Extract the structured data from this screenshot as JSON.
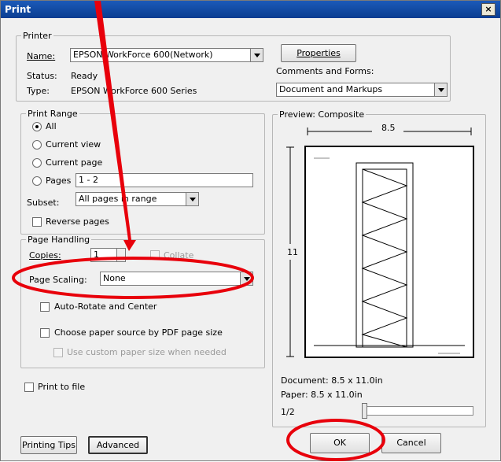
{
  "window": {
    "title": "Print",
    "close_label": "×"
  },
  "printer": {
    "legend": "Printer",
    "name_label": "Name:",
    "name_value": "EPSON WorkForce 600(Network)",
    "status_label": "Status:",
    "status_value": "Ready",
    "type_label": "Type:",
    "type_value": "EPSON WorkForce 600 Series",
    "properties_button": "Properties",
    "comments_label": "Comments and Forms:",
    "comments_value": "Document and Markups"
  },
  "print_range": {
    "legend": "Print Range",
    "all": "All",
    "current_view": "Current view",
    "current_page": "Current page",
    "pages": "Pages",
    "pages_value": "1 - 2",
    "subset_label": "Subset:",
    "subset_value": "All pages in range",
    "reverse_pages": "Reverse pages"
  },
  "page_handling": {
    "legend": "Page Handling",
    "copies_label": "Copies:",
    "copies_value": "1",
    "collate": "Collate",
    "scaling_label": "Page Scaling:",
    "scaling_value": "None",
    "auto_rotate": "Auto-Rotate and Center",
    "choose_paper": "Choose paper source by PDF page size",
    "custom_paper": "Use custom paper size when needed"
  },
  "print_to_file": "Print to file",
  "preview": {
    "legend": "Preview: Composite",
    "width_label": "8.5",
    "height_label": "11",
    "document_size": "Document: 8.5 x 11.0in",
    "paper_size": "Paper: 8.5 x 11.0in",
    "page_indicator": "1/2"
  },
  "buttons": {
    "printing_tips": "Printing Tips",
    "advanced": "Advanced",
    "ok": "OK",
    "cancel": "Cancel"
  },
  "colors": {
    "annotation": "#e8000b",
    "title_bar": "#0a3d91"
  }
}
